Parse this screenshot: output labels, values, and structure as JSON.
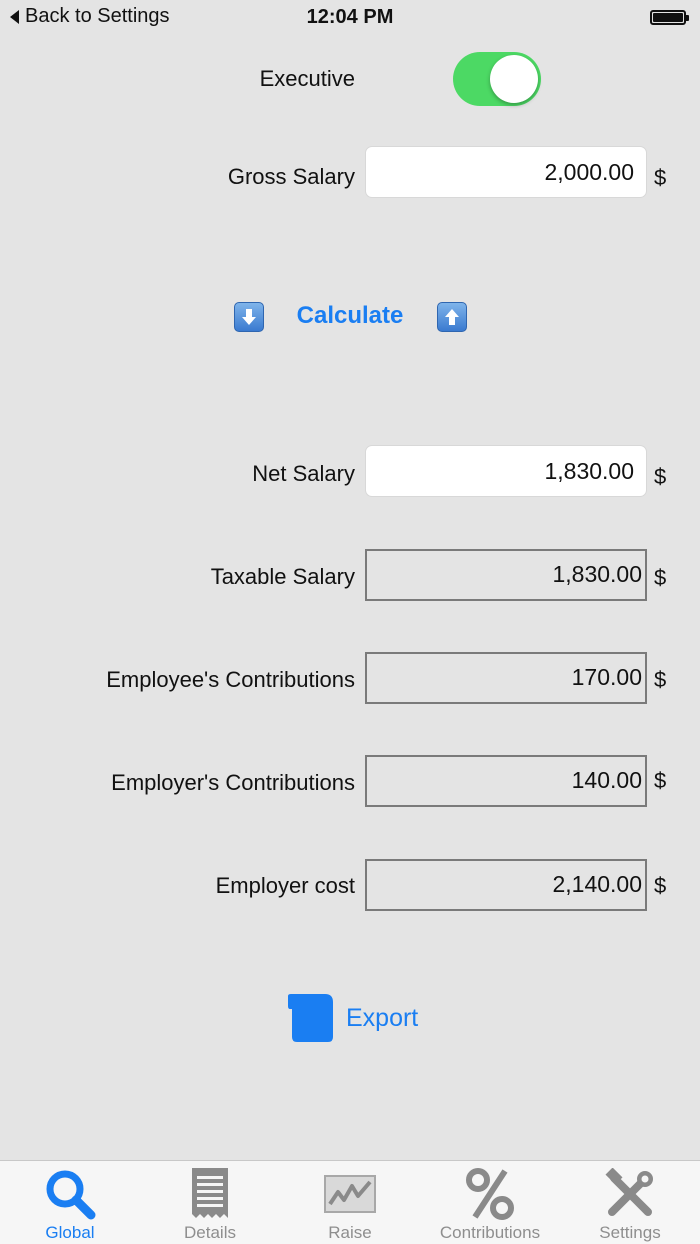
{
  "status_bar": {
    "back_label": "Back to Settings",
    "time": "12:04 PM"
  },
  "form": {
    "executive_label": "Executive",
    "executive_on": true,
    "gross_label": "Gross Salary",
    "gross_value": "2,000.00",
    "currency": "$",
    "calculate_label": "Calculate",
    "net_label": "Net Salary",
    "net_value": "1,830.00",
    "taxable_label": "Taxable Salary",
    "taxable_value": "1,830.00",
    "employee_contrib_label": "Employee's Contributions",
    "employee_contrib_value": "170.00",
    "employer_contrib_label": "Employer's Contributions",
    "employer_contrib_value": "140.00",
    "employer_cost_label": "Employer cost",
    "employer_cost_value": "2,140.00"
  },
  "export_label": "Export",
  "tabs": [
    {
      "label": "Global",
      "icon": "magnifier-icon",
      "active": true
    },
    {
      "label": "Details",
      "icon": "receipt-icon",
      "active": false
    },
    {
      "label": "Raise",
      "icon": "chart-icon",
      "active": false
    },
    {
      "label": "Contributions",
      "icon": "percent-icon",
      "active": false
    },
    {
      "label": "Settings",
      "icon": "tools-icon",
      "active": false
    }
  ],
  "colors": {
    "accent": "#1a7ef2",
    "toggle_on": "#4cd964",
    "background": "#e4e4e4"
  }
}
